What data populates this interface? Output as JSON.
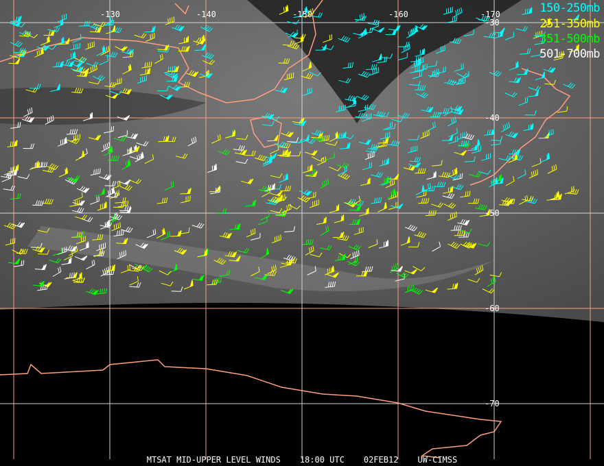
{
  "legend": [
    {
      "label": "150-250mb",
      "color": "#00ffff"
    },
    {
      "label": "251-350mb",
      "color": "#ffff00"
    },
    {
      "label": "351-500mb",
      "color": "#00ff00"
    },
    {
      "label": "501-700mb",
      "color": "#ffffff"
    }
  ],
  "longitude_labels": [
    "-130",
    "-140",
    "-150",
    "-160",
    "-170"
  ],
  "latitude_labels": [
    "-30",
    "-40",
    "-50",
    "-60",
    "-70"
  ],
  "footer": {
    "product": "MTSAT MID-UPPER LEVEL WINDS",
    "time": "18:00 UTC",
    "date": "02FEB12",
    "source": "UW-CIMSS"
  },
  "colors": {
    "coastline": "#ff9f7f",
    "grid_orange": "#ff9f7f",
    "grid_white": "#d8d8d8"
  }
}
